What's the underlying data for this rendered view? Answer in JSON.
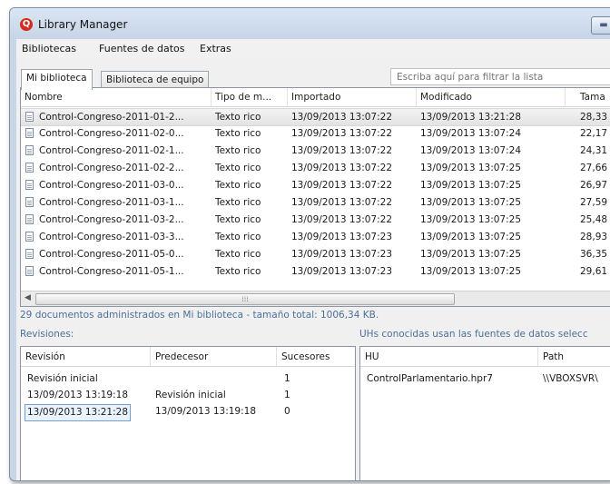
{
  "window": {
    "title": "Library Manager",
    "logo_letter": "Q"
  },
  "menu": [
    "Bibliotecas",
    "Fuentes de datos",
    "Extras"
  ],
  "tabs": [
    "Mi biblioteca",
    "Biblioteca de equipo"
  ],
  "filter": {
    "placeholder": "Escriba aquí para filtrar la lista"
  },
  "doc_list": {
    "columns": [
      "Nombre",
      "Tipo de m...",
      "Importado",
      "Modificado",
      "Tama"
    ],
    "rows": [
      {
        "name": "Control-Congreso-2011-01-2...",
        "type": "Texto rico",
        "imported": "13/09/2013 13:07:22",
        "modified": "13/09/2013 13:21:28",
        "size": "28,33"
      },
      {
        "name": "Control-Congreso-2011-02-0...",
        "type": "Texto rico",
        "imported": "13/09/2013 13:07:22",
        "modified": "13/09/2013 13:07:24",
        "size": "22,17"
      },
      {
        "name": "Control-Congreso-2011-02-1...",
        "type": "Texto rico",
        "imported": "13/09/2013 13:07:22",
        "modified": "13/09/2013 13:07:24",
        "size": "24,31"
      },
      {
        "name": "Control-Congreso-2011-02-2...",
        "type": "Texto rico",
        "imported": "13/09/2013 13:07:22",
        "modified": "13/09/2013 13:07:25",
        "size": "27,66"
      },
      {
        "name": "Control-Congreso-2011-03-0...",
        "type": "Texto rico",
        "imported": "13/09/2013 13:07:22",
        "modified": "13/09/2013 13:07:25",
        "size": "26,97"
      },
      {
        "name": "Control-Congreso-2011-03-1...",
        "type": "Texto rico",
        "imported": "13/09/2013 13:07:22",
        "modified": "13/09/2013 13:07:25",
        "size": "27,59"
      },
      {
        "name": "Control-Congreso-2011-03-2...",
        "type": "Texto rico",
        "imported": "13/09/2013 13:07:22",
        "modified": "13/09/2013 13:07:25",
        "size": "25,48"
      },
      {
        "name": "Control-Congreso-2011-03-3...",
        "type": "Texto rico",
        "imported": "13/09/2013 13:07:23",
        "modified": "13/09/2013 13:07:25",
        "size": "28,93"
      },
      {
        "name": "Control-Congreso-2011-05-0...",
        "type": "Texto rico",
        "imported": "13/09/2013 13:07:23",
        "modified": "13/09/2013 13:07:25",
        "size": "36,35"
      },
      {
        "name": "Control-Congreso-2011-05-1...",
        "type": "Texto rico",
        "imported": "13/09/2013 13:07:23",
        "modified": "13/09/2013 13:07:25",
        "size": "29,61"
      }
    ]
  },
  "status": "29 documentos administrados en Mi biblioteca - tamaño total: 1006,34 KB.",
  "revisions": {
    "label": "Revisiones:",
    "columns": [
      "Revisión",
      "Predecesor",
      "Sucesores"
    ],
    "rows": [
      {
        "revision": "Revisión inicial",
        "predecessor": "",
        "successors": "1"
      },
      {
        "revision": "13/09/2013 13:19:18",
        "predecessor": "Revisión inicial",
        "successors": "1"
      },
      {
        "revision": "13/09/2013 13:21:28",
        "predecessor": "13/09/2013 13:19:18",
        "successors": "0"
      }
    ]
  },
  "hus": {
    "label": "UHs conocidas usan las fuentes de datos selecc",
    "columns": [
      "HU",
      "Path"
    ],
    "rows": [
      {
        "hu": "ControlParlamentario.hpr7",
        "path": "\\\\VBOXSVR\\"
      }
    ]
  },
  "colors": {
    "accent": "#d32c1c",
    "link": "#4b6f97",
    "window_frame": "#c9d6e6"
  }
}
